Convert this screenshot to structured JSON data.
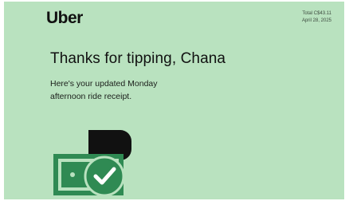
{
  "email": {
    "brand": "Uber",
    "total_line": "Total C$43.11",
    "date_line": "April 28, 2025",
    "headline": "Thanks for tipping, Chana",
    "subtext_line1": "Here's your updated Monday",
    "subtext_line2": "afternoon ride receipt."
  },
  "colors": {
    "background": "#b9e2bf",
    "accent_green": "#2f8a53",
    "black": "#111111"
  },
  "icons": {
    "illustration": "cash-tip-checkmark"
  }
}
